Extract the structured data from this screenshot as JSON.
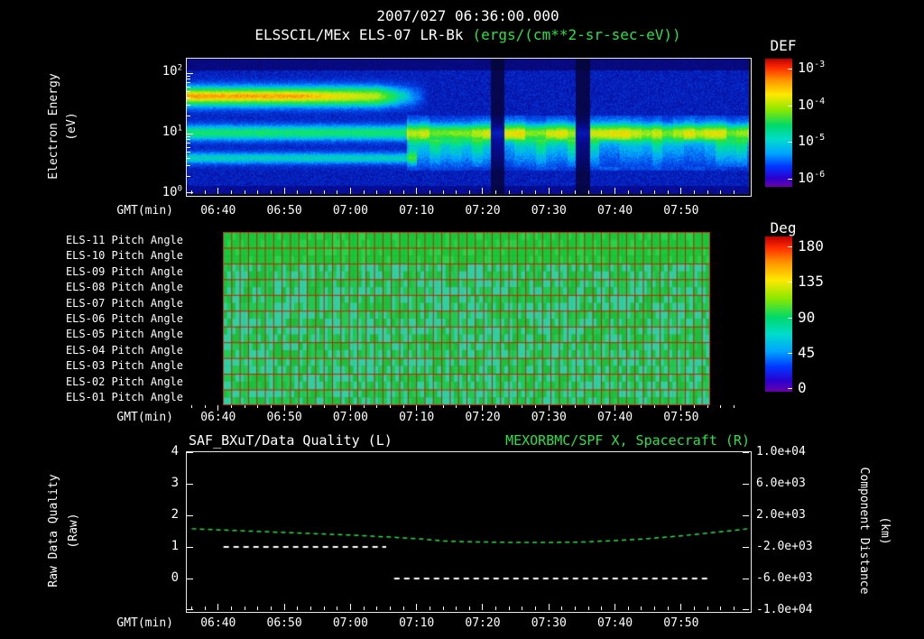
{
  "page": {
    "background": "#000000"
  },
  "colors": {
    "text": "#ffffff",
    "green_text": "#2ce04a",
    "grid_red": "#c32400",
    "series_white": "#ffffff",
    "series_green": "#2ce04a"
  },
  "header": {
    "datetime_title": "2007/027 06:36:00.000",
    "instrument_title": "ELSSCIL/MEx ELS-07 LR-Bk",
    "units_title": "(ergs/(cm**2-sr-sec-eV))"
  },
  "time_axis": {
    "label": "GMT(min)",
    "tick_labels": [
      "06:40",
      "06:50",
      "07:00",
      "07:10",
      "07:20",
      "07:30",
      "07:40",
      "07:50"
    ],
    "tick_minutes": [
      400,
      410,
      420,
      430,
      440,
      450,
      460,
      470
    ],
    "minor_tick_step_min": 2,
    "start_minute": 395.25,
    "end_minute": 480.25
  },
  "chart_data": [
    {
      "id": "electron-energy-spectrogram",
      "type": "heatmap",
      "title": "ELSSCIL/MEx ELS-07 LR-Bk",
      "units": "ergs/(cm**2-sr-sec-eV)",
      "xlabel": "GMT(min)",
      "x_tick_labels": [
        "06:40",
        "06:50",
        "07:00",
        "07:10",
        "07:20",
        "07:30",
        "07:40",
        "07:50"
      ],
      "ylabel_lines": [
        "Electron Energy",
        "(eV)"
      ],
      "y_scale": "log",
      "ylim_ev": [
        1,
        175
      ],
      "y_tick_exponents": [
        "0",
        "1",
        "2"
      ],
      "colorbar": {
        "label": "DEF",
        "tick_base": "10",
        "tick_exponents": [
          "-3",
          "-4",
          "-5",
          "-6"
        ],
        "log10_range": [
          -6,
          -3
        ],
        "colormap": "rainbow"
      },
      "features": {
        "background_level": 0.13,
        "bands": [
          {
            "name": "injection-band-40ev",
            "center_log10_ev": 1.62,
            "sigma_log10": 0.17,
            "amplitude": 0.55,
            "t_full_until": 424,
            "t_gone_by": 432
          },
          {
            "name": "injection-band-core",
            "center_log10_ev": 1.63,
            "sigma_log10": 0.09,
            "amplitude": 0.17,
            "t_full_until": 412,
            "t_gone_by": 426
          },
          {
            "name": "mid-band-10ev",
            "center_log10_ev": 1.02,
            "sigma_log10": 0.13,
            "amplitude": 0.37
          },
          {
            "name": "low-band-4ev",
            "center_log10_ev": 0.6,
            "sigma_log10": 0.1,
            "amplitude": 0.28,
            "t_until": 430
          }
        ],
        "blocky_region": {
          "t_from": 428.5,
          "log10_min": 0.4,
          "log10_max": 1.3,
          "center_log10": 0.85,
          "sigma_log10": 0.38,
          "base": 0.15,
          "variation": 0.2,
          "cell_minutes": 1.6
        },
        "dropout_gaps_min": [
          [
            441.2,
            443.3
          ],
          [
            454.1,
            456.2
          ]
        ]
      }
    },
    {
      "id": "pitch-angle-grid",
      "type": "heatmap",
      "row_labels": [
        "ELS-11 Pitch Angle",
        "ELS-10 Pitch Angle",
        "ELS-09 Pitch Angle",
        "ELS-08 Pitch Angle",
        "ELS-07 Pitch Angle",
        "ELS-06 Pitch Angle",
        "ELS-05 Pitch Angle",
        "ELS-04 Pitch Angle",
        "ELS-03 Pitch Angle",
        "ELS-02 Pitch Angle",
        "ELS-01 Pitch Angle"
      ],
      "xlabel": "GMT(min)",
      "data_t_range_min": [
        400.7,
        474.3
      ],
      "typical_values_deg": {
        "top_rows": 100,
        "lower_rows": 80
      },
      "colorbar": {
        "label": "Deg",
        "ticks": [
          "180",
          "135",
          "90",
          "45",
          "0"
        ],
        "range": [
          0,
          180
        ],
        "colormap": "rainbow"
      }
    },
    {
      "id": "quality-and-component-distance",
      "type": "line",
      "title_left": "SAF_BXuT/Data Quality (L)",
      "title_right": "MEXORBMC/SPF X, Spacecraft (R)",
      "xlabel": "GMT(min)",
      "ylabel_left_lines": [
        "Raw Data Quality",
        "(Raw)"
      ],
      "ylabel_right_lines": [
        "Component Distance",
        "(km)"
      ],
      "left_axis": {
        "tick_labels": [
          "4",
          "3",
          "2",
          "1",
          "0"
        ],
        "tick_values": [
          4,
          3,
          2,
          1,
          0
        ],
        "range": [
          -1,
          4
        ]
      },
      "right_axis": {
        "tick_labels": [
          "1.0e+04",
          "6.0e+03",
          "2.0e+03",
          "-2.0e+03",
          "-6.0e+03",
          "-1.0e+04"
        ],
        "tick_values": [
          10000,
          6000,
          2000,
          -2000,
          -6000,
          -10000
        ],
        "range": [
          -10000,
          10000
        ]
      },
      "series": [
        {
          "name": "SAF_BXuT/Data Quality",
          "axis": "left",
          "color": "#ffffff",
          "style": "dashed",
          "segments": [
            {
              "t_min": [
                400.8,
                425.4
              ],
              "value": 1
            },
            {
              "t_min": [
                426.6,
                474.5
              ],
              "value": 0
            }
          ]
        },
        {
          "name": "MEXORBMC/SPF X Spacecraft",
          "axis": "right",
          "color": "#2ce04a",
          "style": "dashed",
          "points_t_km": [
            [
              396,
              300
            ],
            [
              402,
              100
            ],
            [
              408,
              -100
            ],
            [
              414,
              -300
            ],
            [
              420,
              -500
            ],
            [
              426,
              -750
            ],
            [
              431,
              -1000
            ],
            [
              434,
              -1250
            ],
            [
              438,
              -1350
            ],
            [
              444,
              -1420
            ],
            [
              450,
              -1430
            ],
            [
              455,
              -1380
            ],
            [
              460,
              -1200
            ],
            [
              465,
              -950
            ],
            [
              470,
              -600
            ],
            [
              474,
              -250
            ],
            [
              478,
              100
            ],
            [
              480,
              300
            ]
          ]
        }
      ]
    }
  ]
}
